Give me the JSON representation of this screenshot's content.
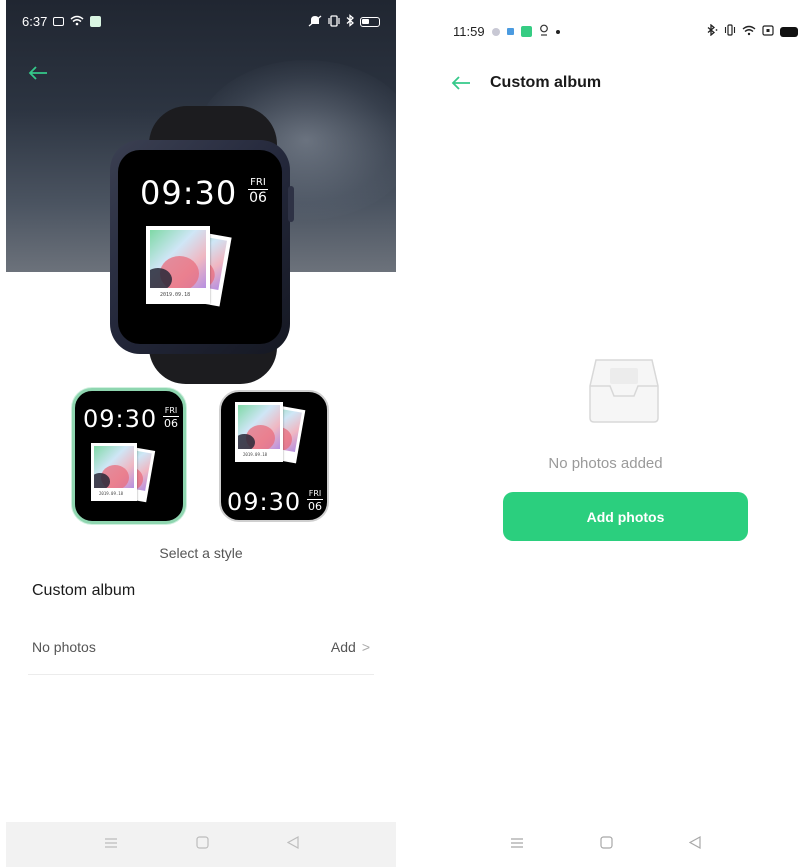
{
  "left_screen": {
    "status_bar": {
      "time": "6:37"
    },
    "watch_preview": {
      "time": "09:30",
      "day": "FRI",
      "date": "06",
      "photo_caption": "2019.09.18"
    },
    "styles": [
      {
        "time": "09:30",
        "day": "FRI",
        "date": "06",
        "photo_caption": "2019.09.18",
        "selected": true
      },
      {
        "time": "09:30",
        "day": "FRI",
        "date": "06",
        "photo_caption": "2019.09.18",
        "selected": false
      }
    ],
    "select_label": "Select a style",
    "section_title": "Custom album",
    "row": {
      "label": "No photos",
      "action": "Add"
    }
  },
  "right_screen": {
    "status_bar": {
      "time": "11:59"
    },
    "title": "Custom album",
    "empty_text": "No photos added",
    "add_button": "Add photos"
  },
  "colors": {
    "accent": "#2bcf7e",
    "back_arrow": "#35c98a"
  },
  "icons": {
    "back": "arrow-left-icon",
    "empty_state": "inbox-tray-icon",
    "nav": [
      "menu-icon",
      "home-square-icon",
      "back-triangle-icon"
    ]
  }
}
